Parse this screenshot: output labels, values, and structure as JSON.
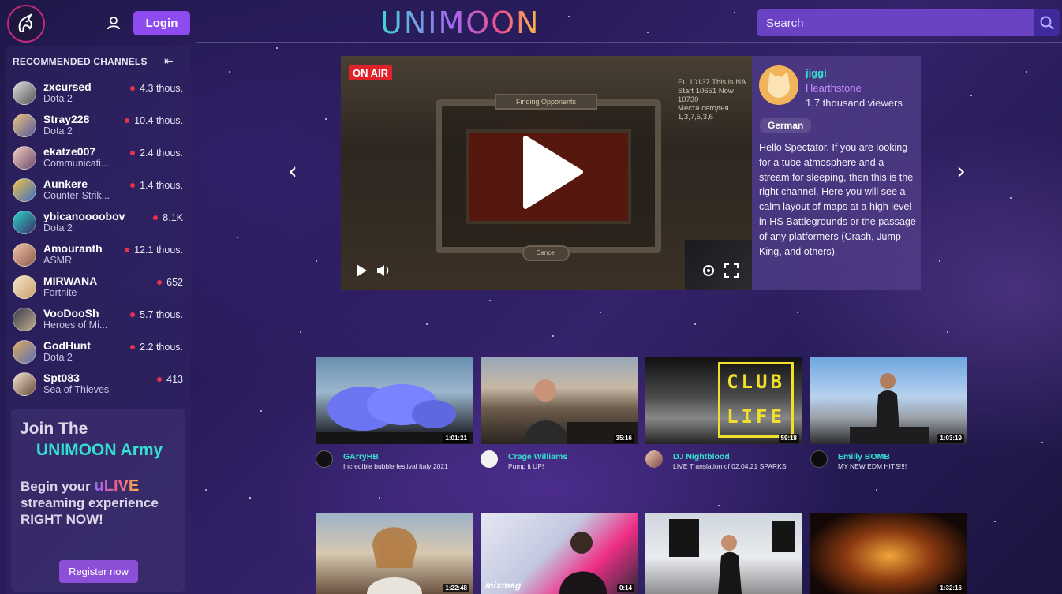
{
  "header": {
    "brand": "UNIMOON",
    "login_label": "Login",
    "search_placeholder": "Search"
  },
  "sidebar": {
    "title": "RECOMMENDED CHANNELS",
    "channels": [
      {
        "name": "zxcursed",
        "game": "Dota 2",
        "viewers": "4.3 thous."
      },
      {
        "name": "Stray228",
        "game": "Dota 2",
        "viewers": "10.4 thous."
      },
      {
        "name": "ekatze007",
        "game": "Communicati...",
        "viewers": "2.4 thous."
      },
      {
        "name": "Aunkere",
        "game": "Counter-Strik...",
        "viewers": "1.4 thous."
      },
      {
        "name": "ybicanoooobov",
        "game": "Dota 2",
        "viewers": "8.1K"
      },
      {
        "name": "Amouranth",
        "game": "ASMR",
        "viewers": "12.1 thous."
      },
      {
        "name": "MIRWANA",
        "game": "Fortnite",
        "viewers": "652"
      },
      {
        "name": "VooDooSh",
        "game": "Heroes of Mi...",
        "viewers": "5.7 thous."
      },
      {
        "name": "GodHunt",
        "game": "Dota 2",
        "viewers": "2.2 thous."
      },
      {
        "name": "Spt083",
        "game": "Sea of Thieves",
        "viewers": "413"
      }
    ],
    "join": {
      "line1": "Join The",
      "line2": "UNIMOON Army",
      "begin_prefix": "Begin your",
      "ulive": "uLIVE",
      "begin_rest": "streaming experience RIGHT NOW!",
      "register_label": "Register now"
    }
  },
  "featured": {
    "on_air": "ON AIR",
    "stats_line1": "Eu 10137 This is NA",
    "stats_line2": "Start 10651 Now 10730",
    "stats_line3": "Места сегодня",
    "stats_line4": "1,3,7,5,3,6",
    "finding_label": "Finding Opponents",
    "cancel_label": "Cancel",
    "streamer": "jiggi",
    "game": "Hearthstone",
    "viewers": "1.7 thousand viewers",
    "language": "German",
    "description": "Hello Spectator. If you are looking for a tube atmosphere and a stream for sleeping, then this is the right channel. Here you will see a calm layout of maps at a high level in HS Battlegrounds or the passage of any platformers (Crash, Jump King, and others)."
  },
  "videos": [
    {
      "channel": "GArryHB",
      "title": "Incredible bubble festival Italy 2021",
      "duration": "1:01:21"
    },
    {
      "channel": "Crage Williams",
      "title": "Pump it UP!",
      "duration": "35:16"
    },
    {
      "channel": "DJ Nightblood",
      "title": "LIVE Translation of 02.04.21 SPARKS",
      "duration": "59:18"
    },
    {
      "channel": "Emilly BOMB",
      "title": "MY NEW EDM HITS!!!!",
      "duration": "1:03:19"
    },
    {
      "channel": "",
      "title": "",
      "duration": "1:22:48"
    },
    {
      "channel": "",
      "title": "",
      "duration": "0:14"
    },
    {
      "channel": "",
      "title": "",
      "duration": ""
    },
    {
      "channel": "",
      "title": "",
      "duration": "1:32:16"
    }
  ],
  "video_overlays": {
    "club_life": "CLUB LIFE",
    "mixmag": "mixmag"
  },
  "colors": {
    "accent": "#8e4bf0",
    "teal": "#36e0cf",
    "live": "#e8334d",
    "onair": "#e0222b"
  }
}
